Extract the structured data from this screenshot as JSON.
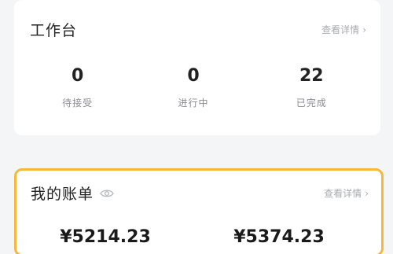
{
  "workbench": {
    "title": "工作台",
    "detail_label": "查看详情",
    "stats": [
      {
        "value": "0",
        "label": "待接受"
      },
      {
        "value": "0",
        "label": "进行中"
      },
      {
        "value": "22",
        "label": "已完成"
      }
    ]
  },
  "bill": {
    "title": "我的账单",
    "visibility_icon": "eye-icon",
    "detail_label": "查看详情",
    "amounts": [
      "¥5214.23",
      "¥5374.23"
    ],
    "highlight_color": "#f5b83b"
  }
}
